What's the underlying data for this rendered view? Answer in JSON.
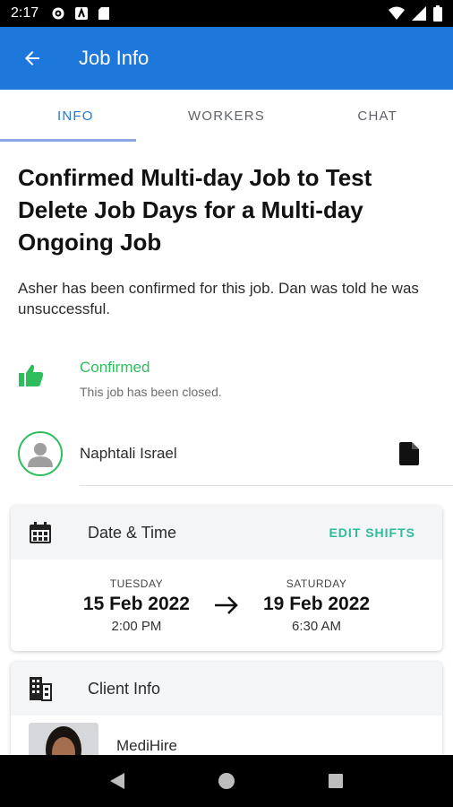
{
  "status_bar": {
    "time": "2:17"
  },
  "app_bar": {
    "title": "Job Info"
  },
  "tabs": [
    {
      "label": "INFO",
      "active": true
    },
    {
      "label": "WORKERS",
      "active": false
    },
    {
      "label": "CHAT",
      "active": false
    }
  ],
  "job": {
    "title": "Confirmed Multi-day Job to Test Delete Job Days for a Multi-day Ongoing Job",
    "description": "Asher has been confirmed for this job. Dan was told he was unsuccessful."
  },
  "status": {
    "label": "Confirmed",
    "sub": "This job has been closed."
  },
  "person": {
    "name": "Naphtali Israel"
  },
  "date_time": {
    "header": "Date & Time",
    "action": "EDIT SHIFTS",
    "start": {
      "day": "TUESDAY",
      "date": "15 Feb 2022",
      "time": "2:00 PM"
    },
    "end": {
      "day": "SATURDAY",
      "date": "19 Feb 2022",
      "time": "6:30 AM"
    }
  },
  "client": {
    "header": "Client Info",
    "name": "MediHire"
  },
  "colors": {
    "primary": "#1e78dc",
    "success": "#2ebd5c",
    "accent": "#2ebd9c"
  }
}
